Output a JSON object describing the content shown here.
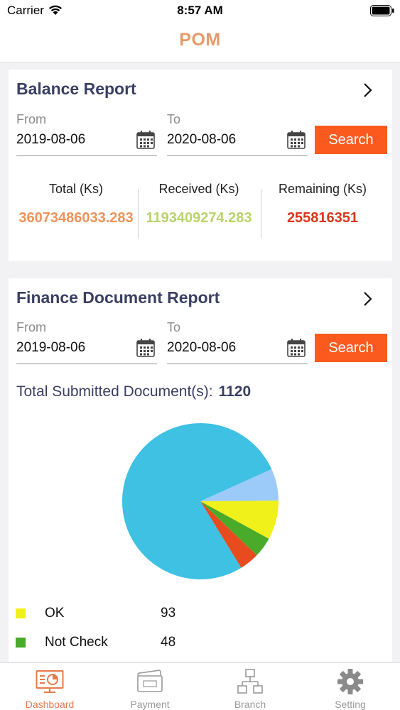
{
  "status_bar": {
    "carrier": "Carrier",
    "time": "8:57 AM"
  },
  "nav": {
    "title": "POM"
  },
  "balance_report": {
    "title": "Balance Report",
    "from_label": "From",
    "from_value": "2019-08-06",
    "to_label": "To",
    "to_value": "2020-08-06",
    "search_label": "Search",
    "stats": [
      {
        "label": "Total (Ks)",
        "value": "36073486033.283",
        "color": "#f0935a"
      },
      {
        "label": "Received (Ks)",
        "value": "1193409274.283",
        "color": "#b8d36a"
      },
      {
        "label": "Remaining (Ks)",
        "value": "255816351",
        "color": "#d8371c"
      }
    ]
  },
  "finance_report": {
    "title": "Finance Document Report",
    "from_label": "From",
    "from_value": "2019-08-06",
    "to_label": "To",
    "to_value": "2020-08-06",
    "search_label": "Search",
    "total_label": "Total Submitted Document(s):",
    "total_value": "1120",
    "legend": [
      {
        "label": "OK",
        "value": "93",
        "color": "#f0f01a"
      },
      {
        "label": "Not Check",
        "value": "48",
        "color": "#4aaa2a"
      }
    ]
  },
  "chart_data": {
    "type": "pie",
    "slices": [
      {
        "name": "",
        "value": 0.068,
        "color": "#9ccbf9"
      },
      {
        "name": "OK",
        "value": 93,
        "color": "#f0f01a"
      },
      {
        "name": "Not Check",
        "value": 48,
        "color": "#4aaa2a"
      },
      {
        "name": "",
        "value": 0.042,
        "color": "#e84b1d"
      },
      {
        "name": "",
        "value": 0.79,
        "color": "#3ec1e2"
      }
    ],
    "note_fractions_for_unlabeled": true
  },
  "tabs": [
    {
      "label": "Dashboard",
      "icon": "dashboard-icon",
      "active": true
    },
    {
      "label": "Payment",
      "icon": "payment-icon",
      "active": false
    },
    {
      "label": "Branch",
      "icon": "branch-icon",
      "active": false
    },
    {
      "label": "Setting",
      "icon": "gear-icon",
      "active": false
    }
  ],
  "colors": {
    "accent": "#fb5a1e",
    "title": "#3a3f63",
    "nav_title": "#e89a6a"
  }
}
